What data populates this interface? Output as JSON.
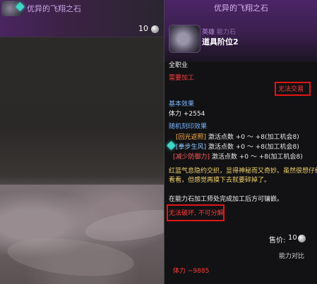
{
  "left_card": {
    "title": "优异的飞翔之石",
    "count": "10"
  },
  "tooltip": {
    "title": "优异的飞翔之石",
    "item_type_a": "英雄",
    "item_type_b": "能力石",
    "grade": "道具阶位2",
    "class": "全职业",
    "requirement": "需要加工",
    "trade_status": "无法交易",
    "base_effect_label": "基本效果",
    "base_effect_value": "体力 +2554",
    "random_label": "随机刻印效果",
    "options": [
      {
        "tag": "[回光返照]",
        "text": " 激活点数 +0 ～ +8(加工机会8)",
        "color": "orange"
      },
      {
        "tag": "[拳步生风]",
        "text": " 激活点数 +0 ～ +8(加工机会8)",
        "color": "blue"
      },
      {
        "tag": "[减少防御力]",
        "text": " 激活点数 +0 ～ +8(加工机会8)",
        "color": "red"
      }
    ],
    "flavor_line1": "红蓝气息隐约交织，显得神秘而又奇妙。虽然很想仔细",
    "flavor_line2": "看看，但感觉再摸下去就要碎掉了。",
    "note": "在能力石加工师处完成加工后方可镶嵌。",
    "restrict_a": "无法破坏",
    "restrict_b": "不可分解",
    "price_label": "售价:",
    "price_value": "10",
    "compare_label": "能力对比",
    "stat_diff": "体力 −9885"
  }
}
